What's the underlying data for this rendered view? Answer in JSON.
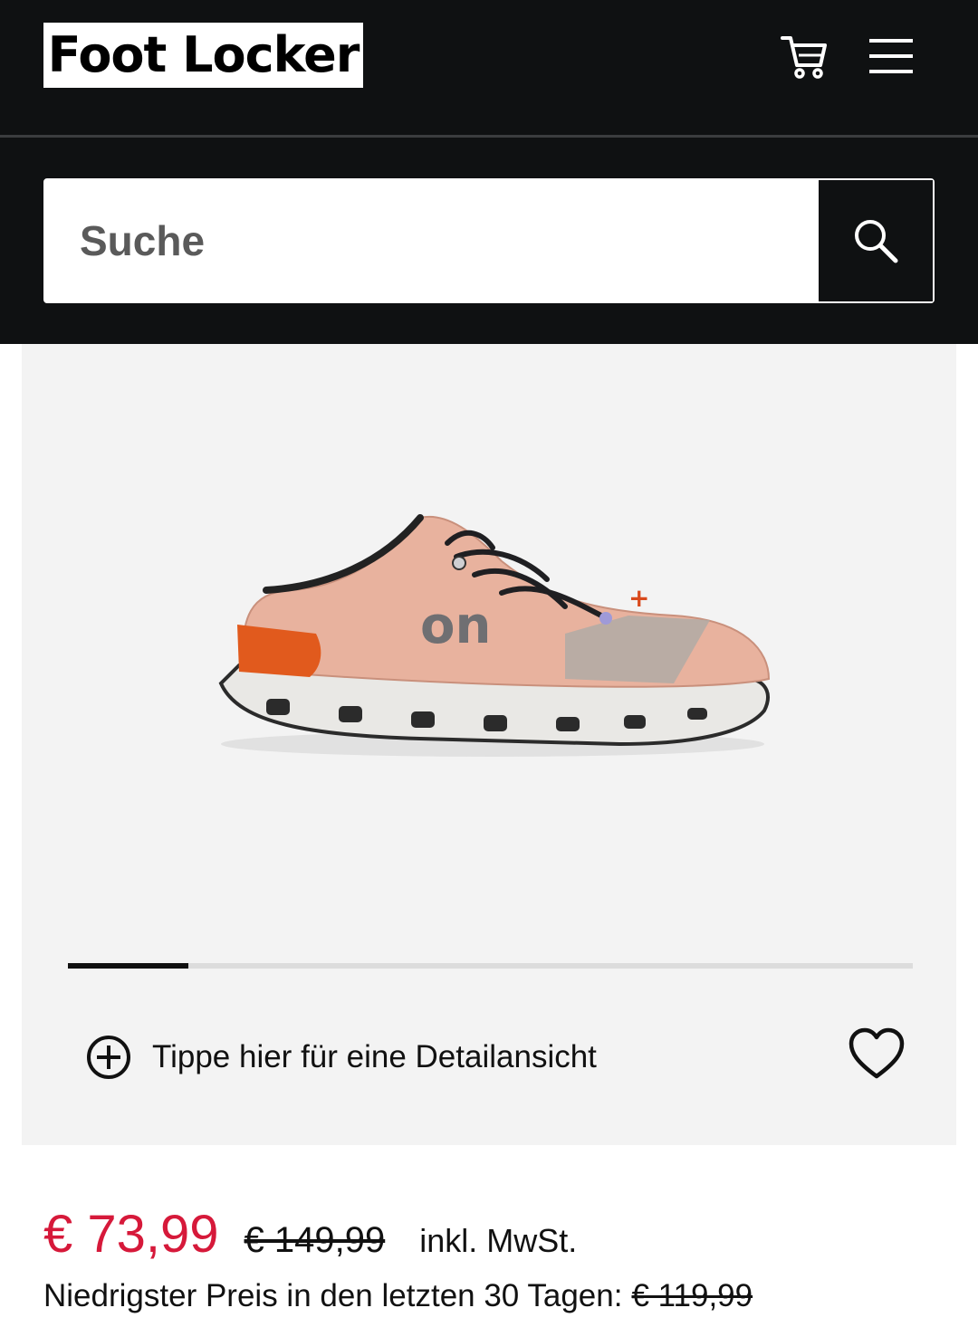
{
  "header": {
    "logo_text": "Foot Locker",
    "cart_icon": "cart-icon",
    "menu_icon": "hamburger-menu-icon"
  },
  "search": {
    "placeholder": "Suche",
    "button_icon": "search-icon"
  },
  "gallery": {
    "image_alt": "On Cloud X 3 Laufschuh rosa",
    "progress": 0.143,
    "detail_icon": "plus-circle-icon",
    "detail_text": "Tippe hier für eine Detailansicht",
    "wishlist_icon": "heart-icon"
  },
  "pricing": {
    "current": "€ 73,99",
    "original": "€ 149,99",
    "tax_note": "inkl. MwSt.",
    "lowest_label": "Niedrigster Preis in den letzten 30 Tagen:",
    "lowest_value": "€ 119,99"
  },
  "colors": {
    "header_bg": "#0f1112",
    "sale_red": "#d6193a",
    "gallery_bg": "#f3f3f3"
  }
}
